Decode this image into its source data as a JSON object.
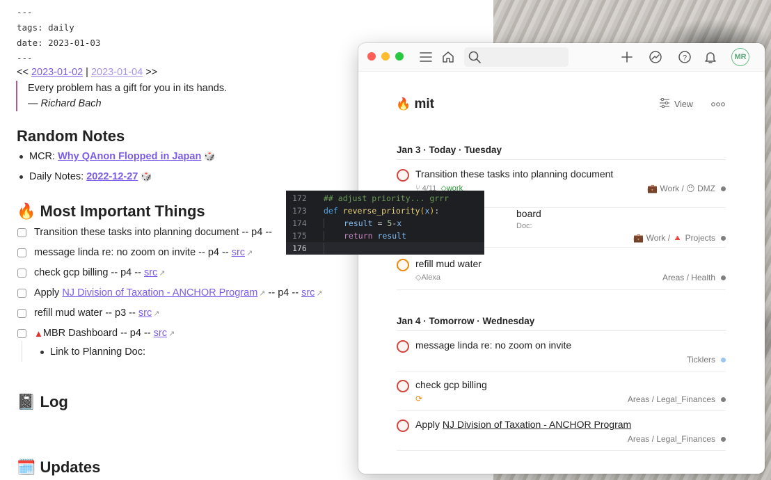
{
  "note": {
    "frontmatter": [
      "---",
      "tags: daily",
      "date: 2023-01-03",
      "---"
    ],
    "nav": {
      "prefix": "<<",
      "prev": "2023-01-02",
      "sep": "|",
      "next": "2023-01-04",
      "suffix": ">>"
    },
    "quote": {
      "text": "Every problem has a gift for you in its hands.",
      "author": "— Richard Bach"
    },
    "random_notes": {
      "heading": "Random Notes",
      "items": [
        {
          "label": "MCR:",
          "link": "Why QAnon Flopped in Japan",
          "icon": "dice-icon"
        },
        {
          "label": "Daily Notes:",
          "link": "2022-12-27",
          "icon": "dice-icon"
        }
      ]
    },
    "mit": {
      "heading": "Most Important Things",
      "emoji": "🔥",
      "tasks": [
        {
          "pre": "Transition these tasks into planning document -- p4 --",
          "link": "",
          "post": ""
        },
        {
          "pre": "message linda re: no zoom on invite -- p4 --",
          "link": "src",
          "post": ""
        },
        {
          "pre": "check gcp billing -- p4 --",
          "link": "src",
          "post": ""
        },
        {
          "pre": "Apply",
          "link2": "NJ Division of Taxation - ANCHOR Program",
          "mid": "-- p4 --",
          "link": "src"
        },
        {
          "pre": "refill mud water -- p3 --",
          "link": "src",
          "post": ""
        },
        {
          "pre": "MBR Dashboard -- p4 --",
          "link": "src",
          "post": ""
        }
      ],
      "child": "Link to Planning Doc:"
    },
    "log": {
      "heading": "Log",
      "emoji": "📓"
    },
    "updates": {
      "heading": "Updates",
      "emoji": "🗓️"
    }
  },
  "code": {
    "lines": [
      {
        "n": "172",
        "text": "## adjust priority... grrr"
      },
      {
        "n": "173",
        "kw": "def",
        "fn": "reverse_priority",
        "arg": "x"
      },
      {
        "n": "174",
        "var": "result",
        "eq": "=",
        "num": "5",
        "op": "-",
        "x": "x"
      },
      {
        "n": "175",
        "ret": "return",
        "var": "result"
      },
      {
        "n": "176"
      }
    ]
  },
  "app": {
    "project": {
      "emoji": "🔥",
      "name": "mit"
    },
    "view_label": "View",
    "avatar": "MR",
    "search_placeholder": "",
    "sections": [
      {
        "heading": "Jan 3 · Today · Tuesday",
        "tasks": [
          {
            "title": "Transition these tasks into planning document",
            "meta_sub": "4/11",
            "meta_label": "work",
            "project": "💼 Work / 😶 DMZ",
            "color": "#808080",
            "ring": "red"
          },
          {
            "title": "board",
            "meta_note": "Doc:",
            "project": "💼 Work / 🔺 Projects",
            "color": "#808080",
            "ring": "red"
          },
          {
            "title": "refill mud water",
            "meta_label": "Alexa",
            "project": "Areas / Health",
            "color": "#808080",
            "ring": "orange"
          }
        ]
      },
      {
        "heading": "Jan 4 · Tomorrow · Wednesday",
        "tasks": [
          {
            "title": "message linda re: no zoom on invite",
            "project": "Ticklers",
            "color": "#9ac6f0",
            "ring": "red"
          },
          {
            "title": "check gcp billing",
            "project": "Areas / Legal_Finances",
            "color": "#808080",
            "ring": "red",
            "recurring": true
          },
          {
            "title_pre": "Apply",
            "title_link": "NJ Division of Taxation - ANCHOR Program",
            "project": "Areas / Legal_Finances",
            "color": "#808080",
            "ring": "red"
          }
        ]
      }
    ],
    "colors": {
      "red": "#d1453b",
      "orange": "#eb8909",
      "green": "#6bbf8a"
    }
  }
}
